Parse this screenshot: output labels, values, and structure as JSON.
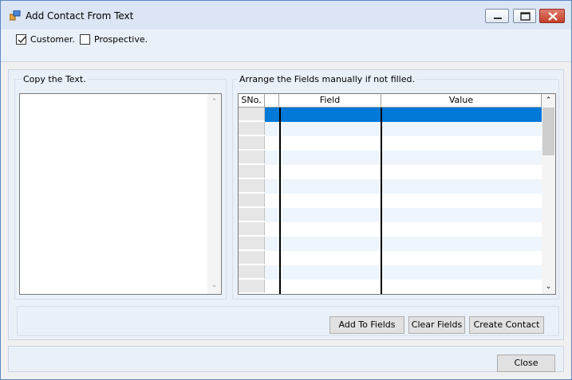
{
  "window": {
    "title": "Add Contact From Text"
  },
  "options": {
    "customer": {
      "label": "Customer.",
      "checked": true
    },
    "prospective": {
      "label": "Prospective.",
      "checked": false
    }
  },
  "left_group": {
    "label": "Copy the Text.",
    "text_value": ""
  },
  "right_group": {
    "label": "Arrange the Fields manually if not filled.",
    "columns": [
      "SNo.",
      "",
      "Field",
      "Value"
    ],
    "row_count": 13,
    "selected_row": 0
  },
  "actions": {
    "add_to_fields": "Add To Fields",
    "clear_fields": "Clear Fields",
    "create_contact": "Create Contact"
  },
  "footer": {
    "close": "Close"
  },
  "colors": {
    "selection": "#0078d7",
    "panel": "#e9f0f8",
    "row_alt": "#eef5fc"
  }
}
